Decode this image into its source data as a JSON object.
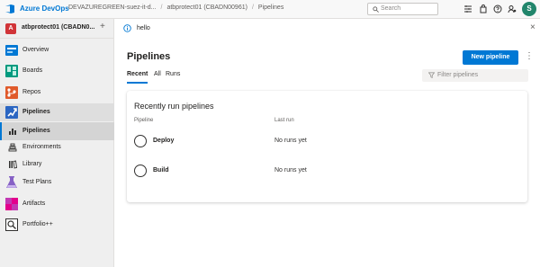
{
  "header": {
    "brand": "Azure DevOps",
    "breadcrumbs": [
      "DEVAZUREGREEN-suez-it-d...",
      "atbprotect01 (CBADN00961)",
      "Pipelines"
    ],
    "search_placeholder": "Search",
    "avatar_initial": "S"
  },
  "sidebar": {
    "project_badge": "A",
    "project_name": "atbprotect01 (CBADN0...",
    "add_symbol": "+",
    "items": [
      {
        "label": "Overview",
        "icon": "overview-icon"
      },
      {
        "label": "Boards",
        "icon": "boards-icon"
      },
      {
        "label": "Repos",
        "icon": "repos-icon"
      },
      {
        "label": "Pipelines",
        "icon": "pipelines-icon"
      },
      {
        "label": "Pipelines",
        "icon": "pipelines-sub-icon"
      },
      {
        "label": "Environments",
        "icon": "environments-icon"
      },
      {
        "label": "Library",
        "icon": "library-icon"
      },
      {
        "label": "Test Plans",
        "icon": "test-plans-icon"
      },
      {
        "label": "Artifacts",
        "icon": "artifacts-icon"
      },
      {
        "label": "Portfolio++",
        "icon": "portfolio-icon"
      }
    ]
  },
  "banner": {
    "text": "hello",
    "close": "×"
  },
  "main": {
    "title": "Pipelines",
    "new_button": "New pipeline",
    "more": "⋮",
    "tabs": [
      "Recent",
      "All",
      "Runs"
    ],
    "filter_placeholder": "Filter pipelines",
    "card": {
      "title": "Recently run pipelines",
      "columns": [
        "Pipeline",
        "Last run"
      ],
      "rows": [
        {
          "name": "Deploy",
          "last_run": "No runs yet"
        },
        {
          "name": "Build",
          "last_run": "No runs yet"
        }
      ]
    }
  },
  "colors": {
    "accent": "#0078d4",
    "avatar": "#21856b",
    "project_badge": "#d13438"
  }
}
